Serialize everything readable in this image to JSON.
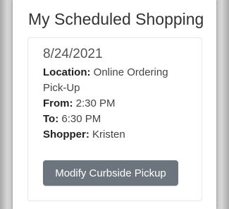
{
  "header": {
    "title": "My Scheduled Shopping"
  },
  "appointment": {
    "date": "8/24/2021",
    "location_label": "Location:",
    "location_value": "Online Ordering Pick-Up",
    "from_label": "From:",
    "from_value": "2:30 PM",
    "to_label": "To:",
    "to_value": "6:30 PM",
    "shopper_label": "Shopper:",
    "shopper_value": "Kristen",
    "modify_button_label": "Modify Curbside Pickup"
  },
  "colors": {
    "button_bg": "#6c757d",
    "button_text": "#ffffff",
    "title_text": "#333333"
  }
}
